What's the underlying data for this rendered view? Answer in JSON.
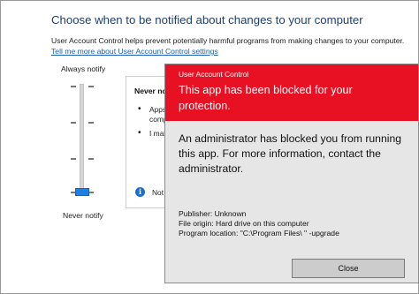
{
  "settings": {
    "title": "Choose when to be notified about changes to your computer",
    "description": "User Account Control helps prevent potentially harmful programs from making changes to your computer.",
    "link": "Tell me more about User Account Control settings",
    "slider": {
      "top_label": "Always notify",
      "bottom_label": "Never notify",
      "level_count": 4,
      "selected_level": 1
    },
    "panel": {
      "title": "Never not",
      "bullets": [
        {
          "lines": [
            "Apps",
            "compu"
          ]
        },
        {
          "lines": [
            "I mak"
          ]
        }
      ],
      "note": "Not r",
      "info_icon": "info-icon"
    }
  },
  "dialog": {
    "caption": "User Account Control",
    "heading": "This app has been blocked for your protection.",
    "message": "An administrator has blocked you from running this app. For more information, contact the administrator.",
    "details": [
      "Publisher: Unknown",
      "File origin: Hard drive on this computer",
      "Program location: \"C:\\Program Files\\     \" -upgrade"
    ],
    "close_label": "Close",
    "header_color": "#e81123"
  }
}
